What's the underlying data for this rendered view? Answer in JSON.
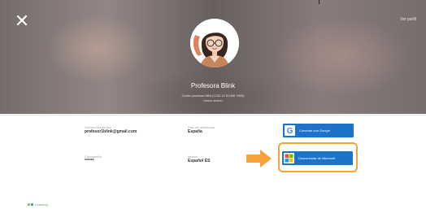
{
  "header": {
    "close_glyph": "✕",
    "top_right_link": "Ver perfil"
  },
  "profile": {
    "name": "Profesora Blink",
    "center_line": "Centro pruebas BBA (COD 12 51456 7890)",
    "status_line": "Iniciar sesión"
  },
  "fields": {
    "email": {
      "label": "Correo electrónico",
      "value": "profesor1blink@gmail.com"
    },
    "country": {
      "label": "País de residencia",
      "value": "España"
    },
    "password": {
      "label": "Contraseña",
      "value": "******"
    },
    "language": {
      "label": "Idioma",
      "value": "Español ES"
    }
  },
  "buttons": {
    "google": {
      "label": "Conectar con Google",
      "icon": "google-icon"
    },
    "microsoft": {
      "label": "Desconectar de Microsoft",
      "icon": "microsoft-icon"
    }
  },
  "annotation": {
    "arrow_color": "#f7a23a",
    "highlight_color": "#f7a23a"
  },
  "footer": {
    "logo_text": "Learning"
  },
  "colors": {
    "button_blue": "#1d73c9",
    "accent_orange": "#f7a23a"
  }
}
